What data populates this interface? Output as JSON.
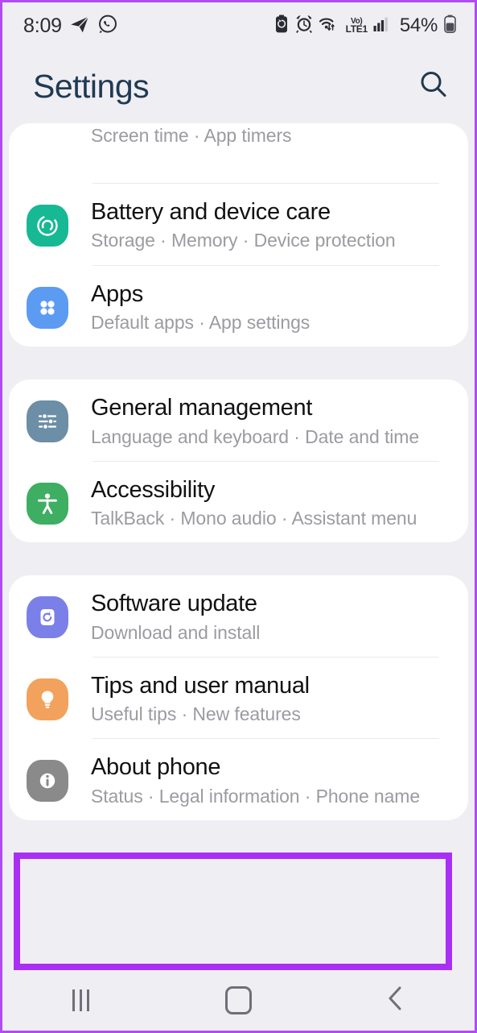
{
  "status_bar": {
    "time": "8:09",
    "left_icons": [
      "telegram-icon",
      "whatsapp-icon"
    ],
    "right_icons": [
      "battery-saver-icon",
      "alarm-icon",
      "wifi-icon",
      "volte-icon",
      "signal-icon"
    ],
    "volte_top": "Vo)",
    "volte_bottom": "LTE1",
    "battery_percent": "54%"
  },
  "header": {
    "title": "Settings",
    "search_icon": "search-icon"
  },
  "colors": {
    "background": "#efeef3",
    "card": "#ffffff",
    "title_text": "#1f3a54",
    "row_title": "#111114",
    "row_subtitle": "#9b9ba1",
    "highlight": "#aa2ff5",
    "battery_icon": "#17b894",
    "apps_icon": "#5b9bf2",
    "general_icon": "#6c8ea6",
    "accessibility_icon": "#3eae62",
    "software_icon": "#7b7fe8",
    "tips_icon": "#f2a25c",
    "about_icon": "#8a8a8a"
  },
  "groups": [
    {
      "partial": true,
      "rows": [
        {
          "partial": true,
          "title": "",
          "subtitle_parts": [
            "Screen time",
            "App timers"
          ],
          "icon": "digital-wellbeing-icon"
        },
        {
          "title": "Battery and device care",
          "subtitle_parts": [
            "Storage",
            "Memory",
            "Device protection"
          ],
          "icon": "battery-device-care-icon"
        },
        {
          "title": "Apps",
          "subtitle_parts": [
            "Default apps",
            "App settings"
          ],
          "icon": "apps-icon"
        }
      ]
    },
    {
      "rows": [
        {
          "title": "General management",
          "subtitle_parts": [
            "Language and keyboard",
            "Date and time"
          ],
          "icon": "general-management-icon"
        },
        {
          "title": "Accessibility",
          "subtitle_parts": [
            "TalkBack",
            "Mono audio",
            "Assistant menu"
          ],
          "icon": "accessibility-icon"
        }
      ]
    },
    {
      "rows": [
        {
          "title": "Software update",
          "subtitle_parts": [
            "Download and install"
          ],
          "icon": "software-update-icon"
        },
        {
          "title": "Tips and user manual",
          "subtitle_parts": [
            "Useful tips",
            "New features"
          ],
          "icon": "tips-icon"
        },
        {
          "title": "About phone",
          "subtitle_parts": [
            "Status",
            "Legal information",
            "Phone name"
          ],
          "icon": "about-phone-icon",
          "highlighted": true
        }
      ]
    }
  ],
  "rows_flat": {
    "screen_time": {
      "subtitle": "Screen time · App timers"
    },
    "battery": {
      "title": "Battery and device care",
      "subtitle": "Storage · Memory · Device protection"
    },
    "apps": {
      "title": "Apps",
      "subtitle": "Default apps · App settings"
    },
    "general": {
      "title": "General management",
      "subtitle": "Language and keyboard · Date and time"
    },
    "accessibility": {
      "title": "Accessibility",
      "subtitle": "TalkBack · Mono audio · Assistant menu"
    },
    "software": {
      "title": "Software update",
      "subtitle": "Download and install"
    },
    "tips": {
      "title": "Tips and user manual",
      "subtitle": "Useful tips · New features"
    },
    "about": {
      "title": "About phone",
      "subtitle": "Status · Legal information · Phone name"
    }
  },
  "nav_bar": {
    "recents_label": "recents-button",
    "home_label": "home-button",
    "back_label": "back-button"
  }
}
